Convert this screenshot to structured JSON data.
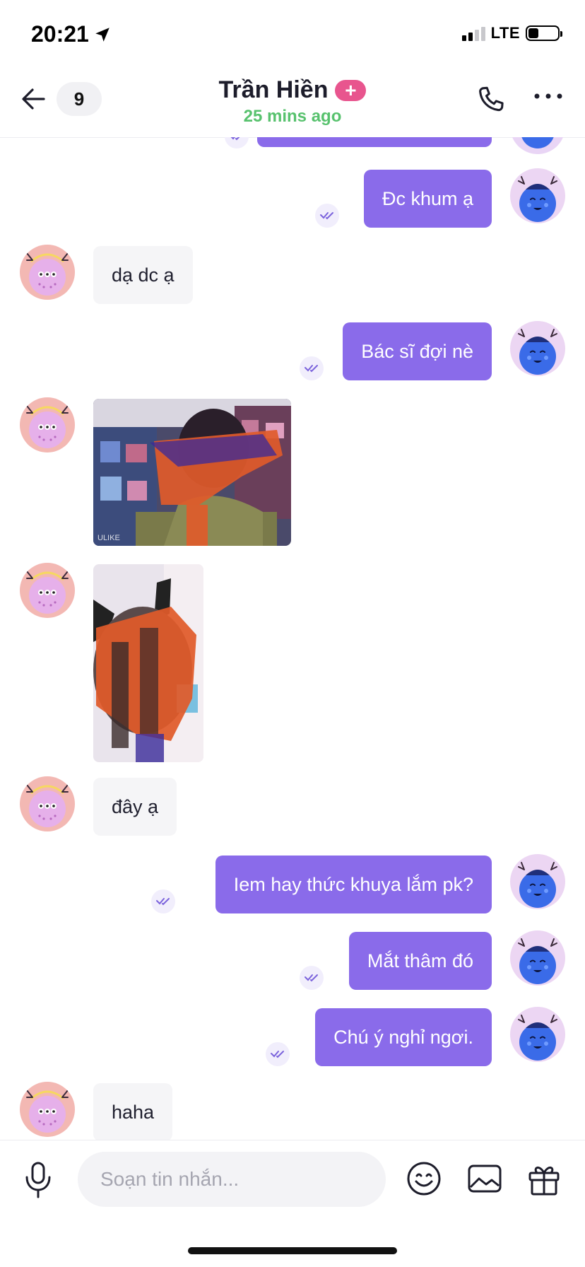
{
  "status_bar": {
    "time": "20:21",
    "network": "LTE",
    "battery_level": 0.35,
    "signal_bars": 2
  },
  "header": {
    "unread_count": "9",
    "contact_name": "Trần Hiền",
    "plus_badge": "+",
    "last_seen": "25 mins ago",
    "icons": {
      "back": "arrow-left-icon",
      "call": "phone-icon",
      "more": "more-horizontal-icon"
    }
  },
  "messages": [
    {
      "from": "me",
      "text": ""
    },
    {
      "from": "me",
      "text": "Đc khum ạ"
    },
    {
      "from": "them",
      "text": "dạ dc ạ"
    },
    {
      "from": "me",
      "text": "Bác sĩ đợi nè"
    },
    {
      "from": "them",
      "type": "image",
      "text": ""
    },
    {
      "from": "them",
      "type": "image",
      "text": ""
    },
    {
      "from": "them",
      "text": "đây ạ"
    },
    {
      "from": "me",
      "text": "Iem hay thức khuya lắm pk?"
    },
    {
      "from": "me",
      "text": "Mắt thâm đó"
    },
    {
      "from": "me",
      "text": "Chú ý nghỉ ngơi."
    },
    {
      "from": "them",
      "text": "haha"
    }
  ],
  "composer": {
    "placeholder": "Soạn tin nhắn...",
    "icons": {
      "mic": "microphone-icon",
      "emoji": "smiley-icon",
      "image": "image-icon",
      "gift": "gift-icon"
    }
  },
  "colors": {
    "outgoing_bubble": "#8a6bea",
    "incoming_bubble": "#f5f5f7",
    "online_text": "#58c26e",
    "plus_badge": "#e8558e"
  }
}
